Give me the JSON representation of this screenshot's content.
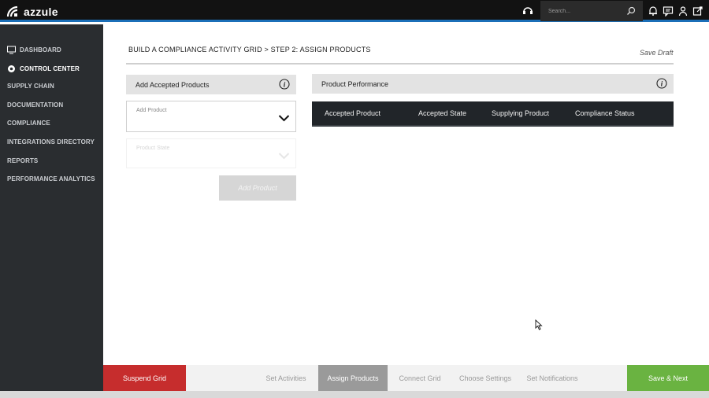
{
  "brand": {
    "name": "azzule"
  },
  "search": {
    "placeholder": "Search..."
  },
  "sidebar": {
    "items": [
      {
        "label": "DASHBOARD",
        "icon": "monitor-icon",
        "active": false
      },
      {
        "label": "CONTROL CENTER",
        "icon": "gear-icon",
        "active": true
      },
      {
        "label": "SUPPLY CHAIN"
      },
      {
        "label": "DOCUMENTATION"
      },
      {
        "label": "COMPLIANCE"
      },
      {
        "label": "INTEGRATIONS DIRECTORY"
      },
      {
        "label": "REPORTS"
      },
      {
        "label": "PERFORMANCE ANALYTICS"
      }
    ]
  },
  "header": {
    "breadcrumb": "BUILD A COMPLIANCE ACTIVITY GRID > STEP 2: ASSIGN PRODUCTS",
    "save_draft": "Save Draft"
  },
  "left_panel": {
    "title": "Add Accepted Products",
    "add_product_label": "Add Product",
    "product_state_label": "Product State",
    "add_button": "Add Product"
  },
  "right_panel": {
    "title": "Product Performance",
    "columns": [
      "Accepted Product",
      "Accepted State",
      "Supplying Product",
      "Compliance Status"
    ]
  },
  "footer": {
    "suspend": "Suspend Grid",
    "steps": [
      "Set Activities",
      "Assign Products",
      "Connect Grid",
      "Choose Settings",
      "Set Notifications"
    ],
    "active_step": "Assign Products",
    "next": "Save & Next"
  },
  "colors": {
    "topbar": "#121212",
    "accent_blue": "#1b6fb8",
    "sidebar": "#2a2d30",
    "suspend_red": "#c62d2d",
    "next_green": "#6ab341",
    "table_header": "#212529"
  }
}
